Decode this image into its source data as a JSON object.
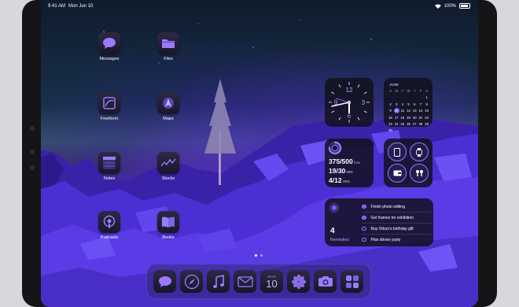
{
  "status_bar": {
    "time": "9:41 AM",
    "date": "Mon Jun 10",
    "battery": "100%"
  },
  "apps": [
    {
      "name": "Messages",
      "icon": "messages-icon"
    },
    {
      "name": "Files",
      "icon": "folder-icon"
    },
    {
      "name": "Freeform",
      "icon": "freeform-icon"
    },
    {
      "name": "Maps",
      "icon": "maps-icon"
    },
    {
      "name": "Notes",
      "icon": "notes-icon"
    },
    {
      "name": "Stocks",
      "icon": "stocks-icon"
    },
    {
      "name": "Podcasts",
      "icon": "podcasts-icon"
    },
    {
      "name": "Books",
      "icon": "books-icon"
    }
  ],
  "clock_widget": {
    "numerals": [
      "12",
      "3",
      "6",
      "9"
    ]
  },
  "calendar_widget": {
    "month": "JUNE",
    "weekdays": [
      "S",
      "M",
      "T",
      "W",
      "T",
      "F",
      "S"
    ],
    "weeks": [
      [
        "",
        "",
        "",
        "",
        "",
        "",
        "1"
      ],
      [
        "2",
        "3",
        "4",
        "5",
        "6",
        "7",
        "8"
      ],
      [
        "9",
        "10",
        "11",
        "12",
        "13",
        "14",
        "15"
      ],
      [
        "16",
        "17",
        "18",
        "19",
        "20",
        "21",
        "22"
      ],
      [
        "23",
        "24",
        "25",
        "26",
        "27",
        "28",
        "29"
      ],
      [
        "30",
        "",
        "",
        "",
        "",
        "",
        ""
      ]
    ],
    "today": "10"
  },
  "fitness_widget": {
    "move": {
      "value": "375/500",
      "unit": "CAL"
    },
    "exercise": {
      "value": "19/30",
      "unit": "MIN"
    },
    "stand": {
      "value": "4/12",
      "unit": "HRS"
    },
    "move_progress": 0.75
  },
  "shortcuts_widget": {
    "icons": [
      "ipad-icon",
      "watch-icon",
      "wallet-icon",
      "airpods-icon"
    ]
  },
  "reminders_widget": {
    "count": "4",
    "label": "Reminders",
    "items": [
      {
        "text": "Finish photo editing",
        "done": true
      },
      {
        "text": "Get frames for exhibition",
        "done": true
      },
      {
        "text": "Buy Orkun's birthday gift",
        "done": false
      },
      {
        "text": "Plan dinner party",
        "done": false
      }
    ]
  },
  "dock": {
    "apps": [
      "messages-icon",
      "safari-icon",
      "music-icon",
      "mail-icon",
      "calendar-icon",
      "photos-icon",
      "camera-icon",
      "app-library-icon"
    ],
    "calendar_day": "MON",
    "calendar_date": "10"
  },
  "page_dots": 2,
  "colors": {
    "accent": "#7f58ff",
    "widget_bg": "#101018",
    "dock_bg": "#322878"
  }
}
